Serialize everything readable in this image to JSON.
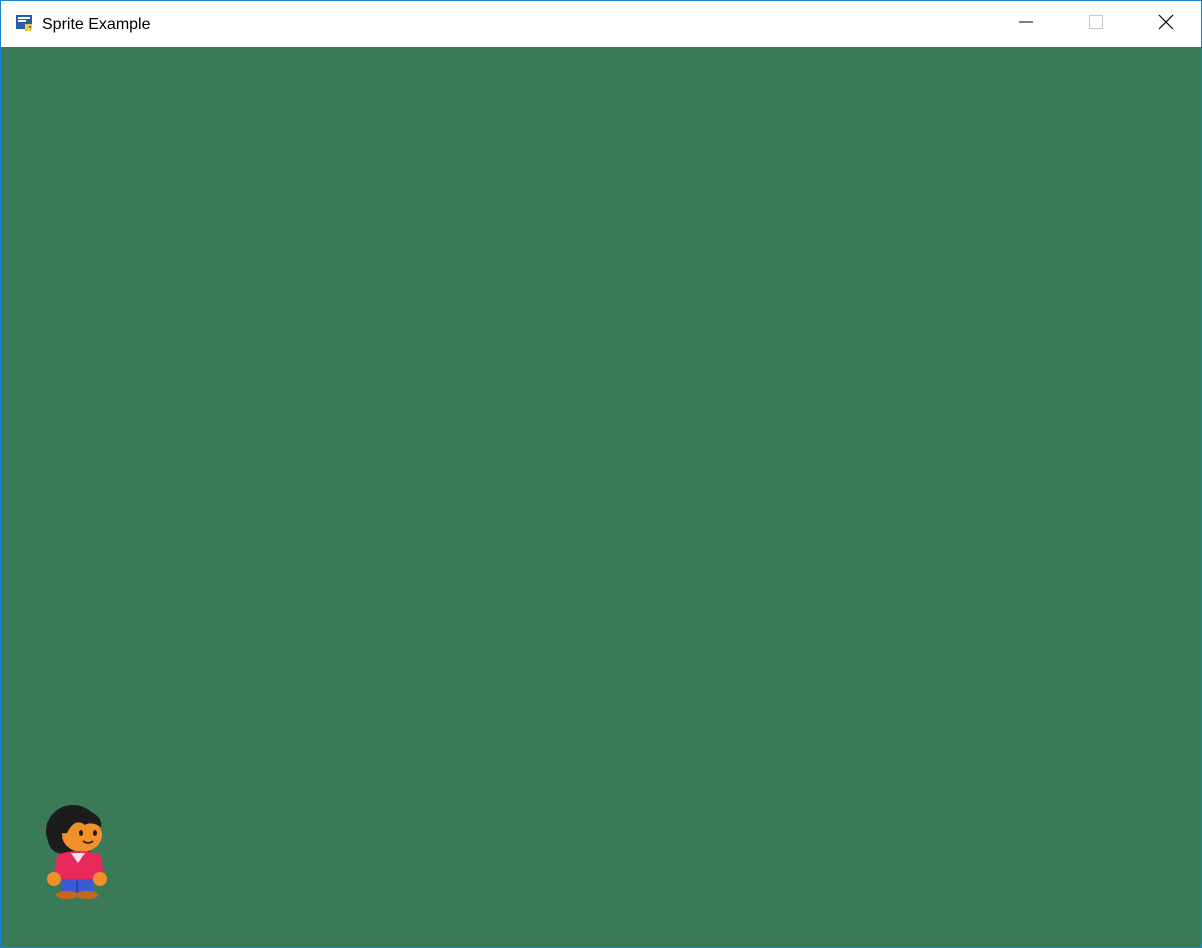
{
  "window": {
    "title": "Sprite Example",
    "app_icon": "python-icon"
  },
  "titlebar": {
    "controls": [
      {
        "name": "minimize",
        "icon": "minimize-icon"
      },
      {
        "name": "maximize",
        "icon": "maximize-icon"
      },
      {
        "name": "close",
        "icon": "close-icon"
      }
    ]
  },
  "canvas": {
    "background": "#3a7a57",
    "sprite": {
      "character": "player-character",
      "hair_color": "#1c1c1c",
      "skin_color": "#f0902a",
      "shirt_color": "#e8295b",
      "pants_color": "#3a5bd4",
      "shoe_color": "#c7661e"
    }
  },
  "colors": {
    "titlebar_bg": "#ffffff",
    "window_border": "#1883d7",
    "text": "#000000"
  }
}
